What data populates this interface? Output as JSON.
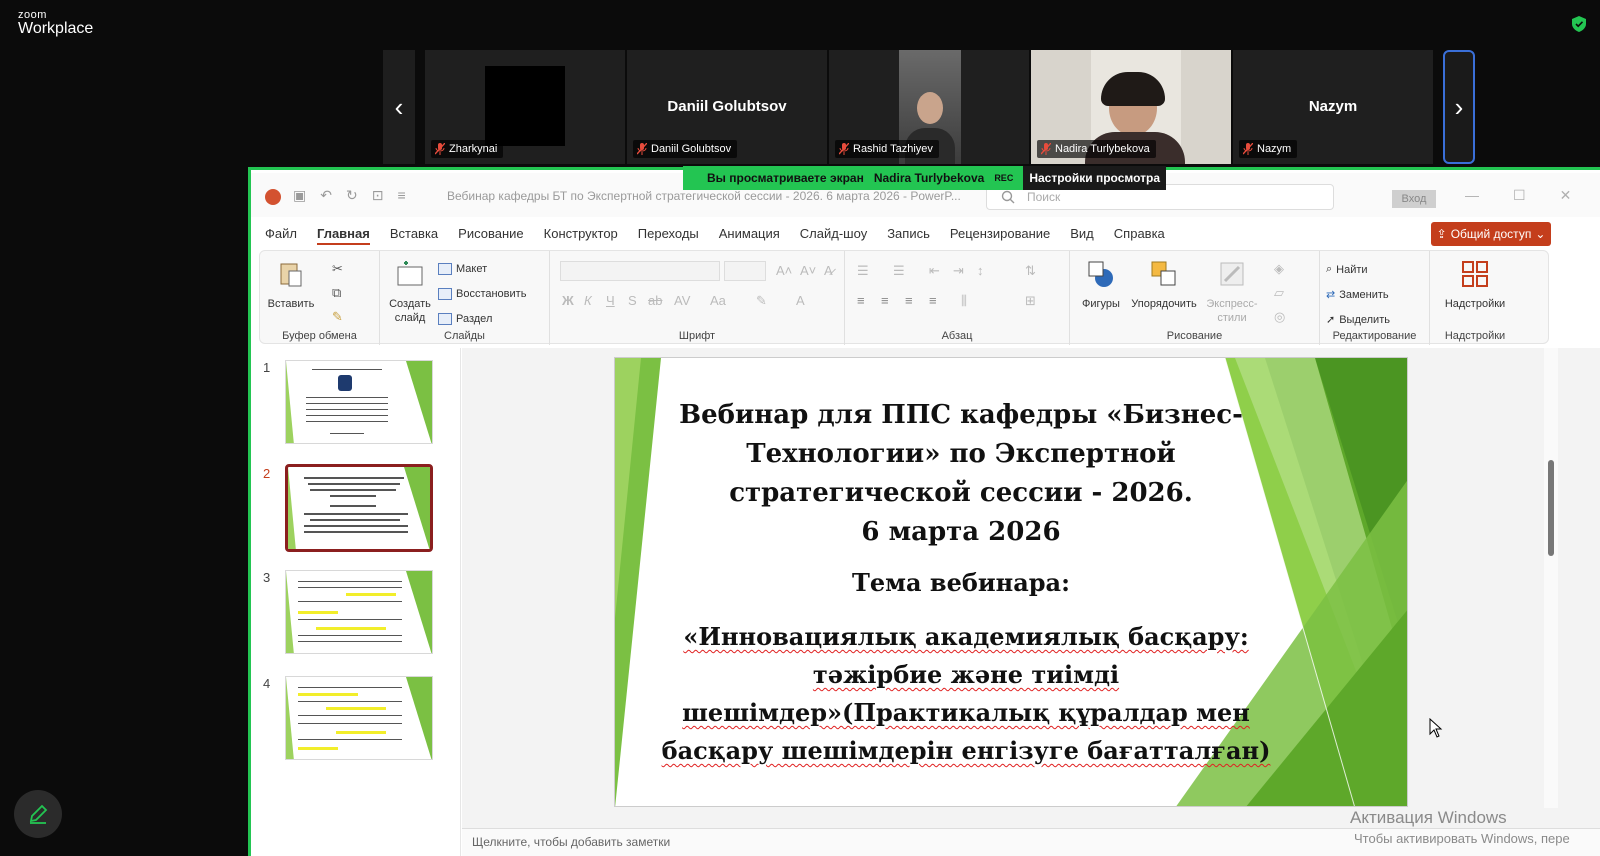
{
  "app": {
    "brand_small": "zoom",
    "brand_big": "Workplace"
  },
  "participants": [
    {
      "name": "Zharkynai",
      "center_name": ""
    },
    {
      "name": "Daniil Golubtsov",
      "center_name": "Daniil Golubtsov"
    },
    {
      "name": "Rashid Tazhiyev",
      "center_name": ""
    },
    {
      "name": "Nadira Turlybekova",
      "center_name": ""
    },
    {
      "name": "Nazym",
      "center_name": "Nazym"
    }
  ],
  "nav": {
    "prev": "‹",
    "next": "›"
  },
  "share_banner": {
    "viewing": "Вы просматриваете экран",
    "presenter": "Nadira Turlybekova",
    "rec": "REC",
    "view_options": "Настройки просмотра"
  },
  "powerpoint": {
    "doc_title": "Вебинар кафедры БТ  по Экспертной стратегической сессии - 2026. 6 марта 2026  -  PowerP...",
    "search_placeholder": "Поиск",
    "sign_in": "Вход",
    "menu": [
      "Файл",
      "Главная",
      "Вставка",
      "Рисование",
      "Конструктор",
      "Переходы",
      "Анимация",
      "Слайд-шоу",
      "Запись",
      "Рецензирование",
      "Вид",
      "Справка"
    ],
    "share_button": "Общий доступ",
    "ribbon": {
      "paste": "Вставить",
      "clipboard": "Буфер обмена",
      "new_slide": "Создать слайд",
      "layout": "Макет",
      "reset": "Восстановить",
      "section": "Раздел",
      "slides": "Слайды",
      "font": "Шрифт",
      "paragraph": "Абзац",
      "shapes": "Фигуры",
      "arrange": "Упорядочить",
      "quick_styles": "Экспресс-стили",
      "drawing": "Рисование",
      "find": "Найти",
      "replace": "Заменить",
      "select": "Выделить",
      "editing": "Редактирование",
      "addins": "Надстройки",
      "addins_group": "Надстройки",
      "format_glyphs": [
        "Ж",
        "К",
        "Ч",
        "S",
        "ab",
        "AV",
        "Aa"
      ]
    },
    "slide_numbers": [
      "1",
      "2",
      "3",
      "4"
    ],
    "notes_placeholder": "Щелкните, чтобы добавить заметки",
    "slide": {
      "title_lines": [
        "Вебинар для ППС кафедры «Бизнес-",
        "Технологии» по Экспертной",
        "стратегической сессии - 2026.",
        "6 марта 2026"
      ],
      "subtitle": "Тема вебинара:",
      "body_lines": [
        "«Инновациялық академиялық басқару:",
        "тәжірбие және тиімді",
        "шешімдер»(Практикалық құралдар мен",
        "басқару шешімдерін енгізуге бағатталған)"
      ]
    }
  },
  "watermark": {
    "line1": "Активация Windows",
    "line2": "Чтобы активировать Windows, пере"
  },
  "colors": {
    "accent_green": "#23c552",
    "pp_orange": "#c43e1c",
    "slide_green": "#6bbf2a"
  }
}
